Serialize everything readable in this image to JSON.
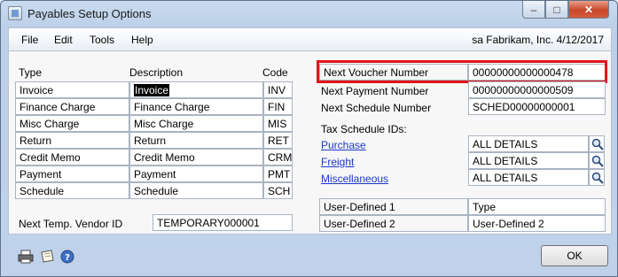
{
  "window": {
    "title": "Payables Setup Options"
  },
  "menu": {
    "items": [
      "File",
      "Edit",
      "Tools",
      "Help"
    ],
    "user_info": "sa  Fabrikam, Inc.  4/12/2017"
  },
  "codes_table": {
    "headers": {
      "type": "Type",
      "description": "Description",
      "code": "Code"
    },
    "rows": [
      {
        "type": "Invoice",
        "description": "Invoice",
        "code": "INV"
      },
      {
        "type": "Finance Charge",
        "description": "Finance Charge",
        "code": "FIN"
      },
      {
        "type": "Misc Charge",
        "description": "Misc Charge",
        "code": "MIS"
      },
      {
        "type": "Return",
        "description": "Return",
        "code": "RET"
      },
      {
        "type": "Credit Memo",
        "description": "Credit  Memo",
        "code": "CRM"
      },
      {
        "type": "Payment",
        "description": "Payment",
        "code": "PMT"
      },
      {
        "type": "Schedule",
        "description": "Schedule",
        "code": "SCH"
      }
    ]
  },
  "temp_vendor": {
    "label": "Next Temp. Vendor ID",
    "value": "TEMPORARY000001"
  },
  "numbers": {
    "next_voucher_label": "Next Voucher Number",
    "next_voucher_value": "00000000000000478",
    "next_payment_label": "Next Payment Number",
    "next_payment_value": "00000000000000509",
    "next_schedule_label": "Next Schedule Number",
    "next_schedule_value": "SCHED00000000001"
  },
  "tax": {
    "heading": "Tax Schedule IDs:",
    "purchase_label": "Purchase",
    "purchase_value": "ALL DETAILS",
    "freight_label": "Freight",
    "freight_value": "ALL DETAILS",
    "misc_label": "Miscellaneous",
    "misc_value": "ALL DETAILS"
  },
  "user_defined": {
    "ud1_label": "User-Defined 1",
    "ud1_value": "Type",
    "ud2_label": "User-Defined 2",
    "ud2_value": "User-Defined 2"
  },
  "buttons": {
    "ok": "OK",
    "minimize": "–",
    "maximize": "□",
    "close": "✕"
  },
  "colors": {
    "highlight_box": "#e0141c",
    "link": "#1a39c8"
  }
}
